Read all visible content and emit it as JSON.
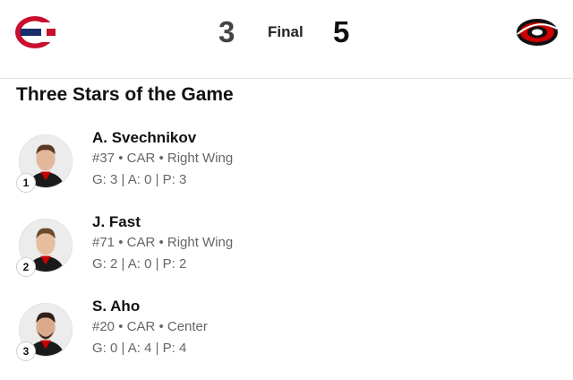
{
  "game": {
    "home_team_logo": "canadiens-logo",
    "away_team_logo": "hurricanes-logo",
    "home_score": "3",
    "status": "Final",
    "away_score": "5"
  },
  "section_title": "Three Stars of the Game",
  "stars": [
    {
      "rank": "1",
      "name": "A. Svechnikov",
      "info": "#37 • CAR • Right Wing",
      "stats": "G: 3 | A: 0 | P: 3"
    },
    {
      "rank": "2",
      "name": "J. Fast",
      "info": "#71 • CAR • Right Wing",
      "stats": "G: 2 | A: 0 | P: 2"
    },
    {
      "rank": "3",
      "name": "S. Aho",
      "info": "#20 • CAR • Center",
      "stats": "G: 0 | A: 4 | P: 4"
    }
  ],
  "colors": {
    "canadiens_red": "#c8102e",
    "canadiens_blue": "#192c6b",
    "hurricanes_red": "#cc0000",
    "jersey": "#1a1a1a"
  }
}
